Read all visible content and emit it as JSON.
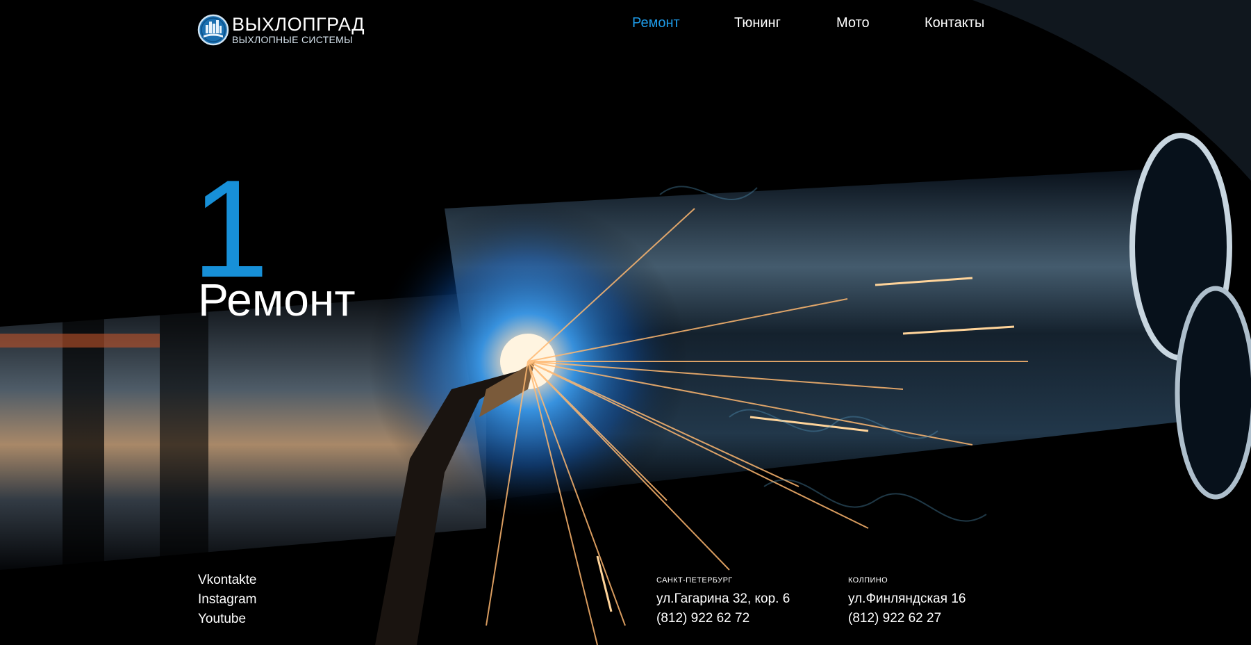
{
  "brand": {
    "title": "ВЫХЛОПГРАД",
    "subtitle": "ВЫХЛОПНЫЕ СИСТЕМЫ",
    "logo_icon": "city-exhaust-logo-icon"
  },
  "nav": {
    "items": [
      {
        "label": "Ремонт",
        "active": true
      },
      {
        "label": "Тюнинг",
        "active": false
      },
      {
        "label": "Мото",
        "active": false
      },
      {
        "label": "Контакты",
        "active": false
      }
    ]
  },
  "hero": {
    "number": "1",
    "title": "Ремонт"
  },
  "social": [
    "Vkontakte",
    "Instagram",
    "Youtube"
  ],
  "contacts": [
    {
      "city": "САНКТ-ПЕТЕРБУРГ",
      "address": "ул.Гагарина 32, кор. 6",
      "phone": "(812) 922 62 72"
    },
    {
      "city": "КОЛПИНО",
      "address": "ул.Финляндская 16",
      "phone": "(812) 922 62 27"
    }
  ],
  "colors": {
    "accent": "#1e9be8",
    "background": "#000000",
    "text": "#ffffff"
  }
}
